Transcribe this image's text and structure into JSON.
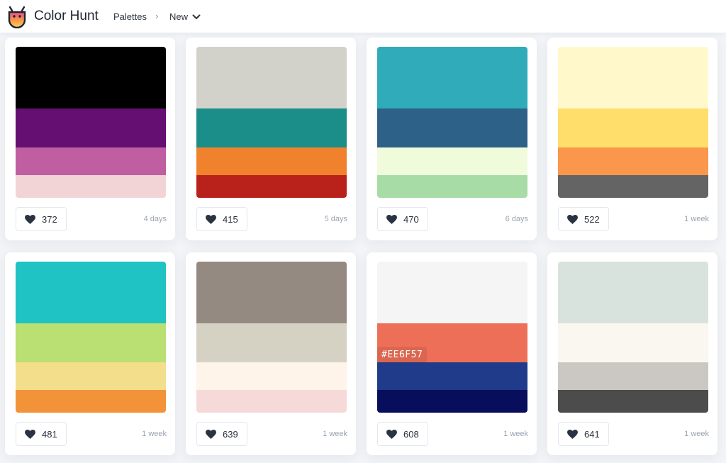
{
  "header": {
    "brand": "Color Hunt",
    "breadcrumb": {
      "palettes": "Palettes",
      "separator": "›",
      "current": "New"
    }
  },
  "palettes": [
    {
      "colors": [
        "#000000",
        "#650F73",
        "#BF5FA2",
        "#F2D4D7"
      ],
      "likes": "372",
      "age": "4 days"
    },
    {
      "colors": [
        "#D3D2CA",
        "#1C8E8A",
        "#F0812D",
        "#B9221A"
      ],
      "likes": "415",
      "age": "5 days"
    },
    {
      "colors": [
        "#30ABB9",
        "#2E6188",
        "#EFFBDB",
        "#A8DCA6"
      ],
      "likes": "470",
      "age": "6 days"
    },
    {
      "colors": [
        "#FFF8CB",
        "#FFDE6B",
        "#FA974C",
        "#646464"
      ],
      "likes": "522",
      "age": "1 week"
    },
    {
      "colors": [
        "#1FC3C4",
        "#BADF72",
        "#F3DE8B",
        "#F29339"
      ],
      "likes": "481",
      "age": "1 week"
    },
    {
      "colors": [
        "#958A82",
        "#D5D2C3",
        "#FEF4EA",
        "#F6DADA"
      ],
      "likes": "639",
      "age": "1 week"
    },
    {
      "colors": [
        "#F5F5F5",
        "#EE6F57",
        "#1F3B8A",
        "#080E5C"
      ],
      "likes": "608",
      "age": "1 week",
      "hover_label": "#EE6F57"
    },
    {
      "colors": [
        "#D9E3DD",
        "#FAF6F0",
        "#CBC8C3",
        "#4C4C4C"
      ],
      "likes": "641",
      "age": "1 week"
    }
  ]
}
